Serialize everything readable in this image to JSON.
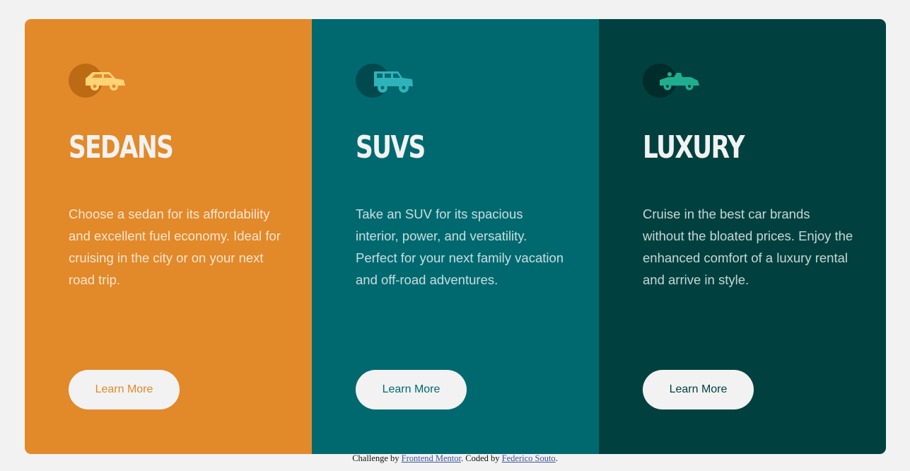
{
  "colors": {
    "page_bg": "#f2f2f2",
    "sedans": "#e28929",
    "suvs": "#006970",
    "luxury": "#004140"
  },
  "cards": [
    {
      "id": "sedans",
      "icon": "sedan-car-icon",
      "title": "SEDANS",
      "text": "Choose a sedan for its affordability and excellent fuel economy. Ideal for cruising in the city or on your next road trip.",
      "button_label": "Learn More"
    },
    {
      "id": "suvs",
      "icon": "suv-car-icon",
      "title": "SUVS",
      "text": "Take an SUV for its spacious interior, power, and versatility. Perfect for your next family vacation and off-road adventures.",
      "button_label": "Learn More"
    },
    {
      "id": "luxury",
      "icon": "luxury-car-icon",
      "title": "LUXURY",
      "text": "Cruise in the best car brands without the bloated prices. Enjoy the enhanced comfort of a luxury rental and arrive in style.",
      "button_label": "Learn More"
    }
  ],
  "footer": {
    "prefix": "Challenge by ",
    "link1": "Frontend Mentor",
    "middle": ". Coded by ",
    "link2": "Federico Souto",
    "suffix": "."
  }
}
